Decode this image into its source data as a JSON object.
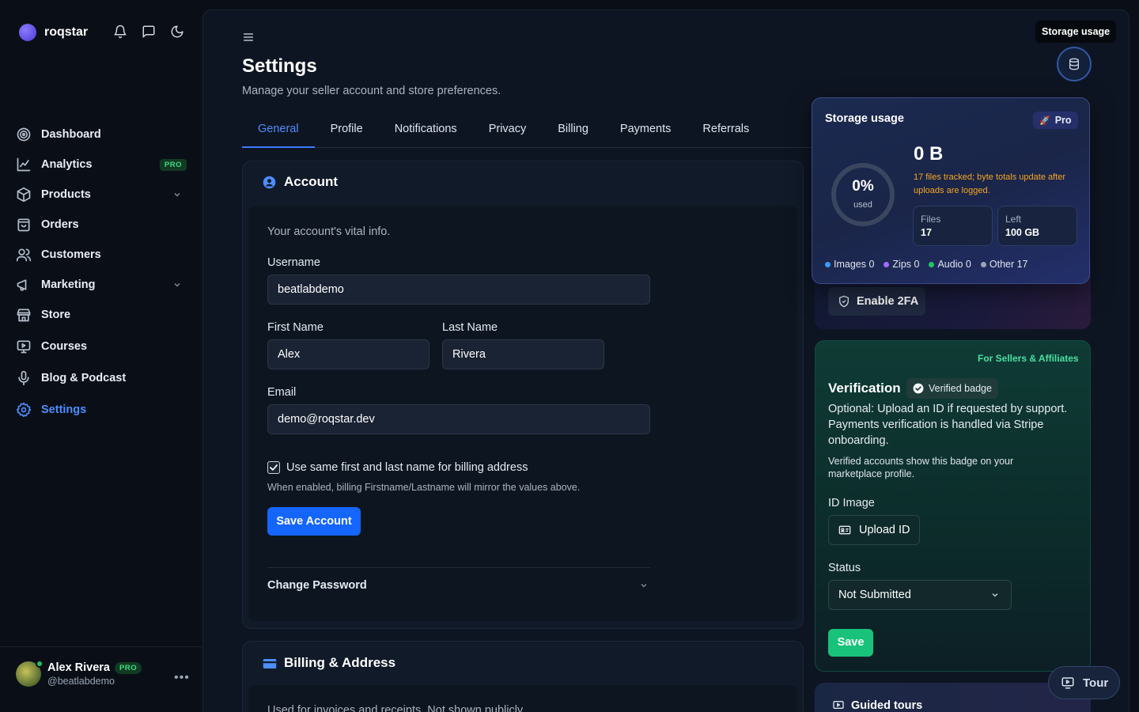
{
  "brand": {
    "name": "roqstar"
  },
  "sidebar": {
    "items": [
      {
        "label": "Dashboard"
      },
      {
        "label": "Analytics",
        "badge": "PRO"
      },
      {
        "label": "Products"
      },
      {
        "label": "Orders"
      },
      {
        "label": "Customers"
      },
      {
        "label": "Marketing"
      },
      {
        "label": "Store"
      },
      {
        "label": "Courses"
      },
      {
        "label": "Blog & Podcast"
      },
      {
        "label": "Settings"
      }
    ]
  },
  "user": {
    "name": "Alex Rivera",
    "badge": "PRO",
    "handle": "@beatlabdemo"
  },
  "page": {
    "title": "Settings",
    "subtitle": "Manage your seller account and store preferences."
  },
  "tabs": [
    "General",
    "Profile",
    "Notifications",
    "Privacy",
    "Billing",
    "Payments",
    "Referrals"
  ],
  "account": {
    "title": "Account",
    "description": "Your account's vital info.",
    "username_label": "Username",
    "username_value": "beatlabdemo",
    "first_name_label": "First Name",
    "first_name_value": "Alex",
    "last_name_label": "Last Name",
    "last_name_value": "Rivera",
    "email_label": "Email",
    "email_value": "demo@roqstar.dev",
    "billing_same_label": "Use same first and last name for billing address",
    "billing_same_checked": true,
    "billing_hint": "When enabled, billing Firstname/Lastname will mirror the values above.",
    "save_label": "Save Account",
    "change_password_label": "Change Password"
  },
  "billing": {
    "title": "Billing & Address",
    "description": "Used for invoices and receipts. Not shown publicly."
  },
  "security": {
    "enable_2fa_label": "Enable 2FA"
  },
  "verification": {
    "tag": "For Sellers & Affiliates",
    "title": "Verification",
    "badge": "Verified badge",
    "text": "Optional: Upload an ID if requested by support. Payments verification is handled via Stripe onboarding.",
    "subtext": "Verified accounts show this badge on your marketplace profile.",
    "id_image_label": "ID Image",
    "upload_label": "Upload ID",
    "status_label": "Status",
    "status_value": "Not Submitted",
    "save_label": "Save"
  },
  "guided_tours": {
    "title": "Guided tours"
  },
  "tour_button": {
    "label": "Tour"
  },
  "storage": {
    "tooltip": "Storage usage",
    "title": "Storage usage",
    "plan": "Pro",
    "percent_label": "0%",
    "percent_value": 0,
    "used_label": "used",
    "size": "0 B",
    "warning": "17 files tracked; byte totals update after uploads are logged.",
    "files_label": "Files",
    "files_value": "17",
    "left_label": "Left",
    "left_value": "100 GB",
    "legend": [
      {
        "label": "Images 0",
        "color": "#3b9bff"
      },
      {
        "label": "Zips 0",
        "color": "#a06bff"
      },
      {
        "label": "Audio 0",
        "color": "#22c55e"
      },
      {
        "label": "Other 17",
        "color": "#9aa5b4"
      }
    ]
  },
  "colors": {
    "accent": "#1565ff",
    "success": "#18c27a",
    "warning": "#f5a623"
  }
}
